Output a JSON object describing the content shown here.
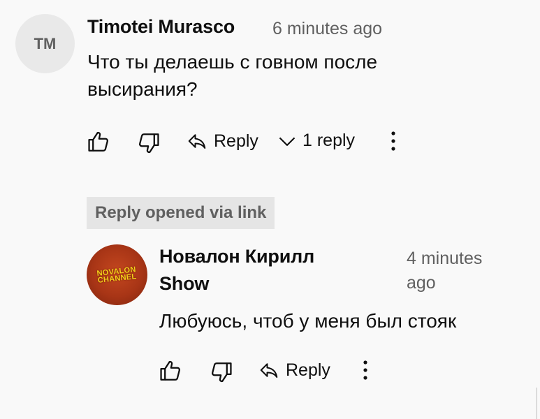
{
  "comment": {
    "avatar_initials": "TM",
    "author": "Timotei Murasco",
    "time": "6 minutes ago",
    "text_line1": "Что ты делаешь с говном после",
    "text_line2": "высирания?",
    "reply_label": "Reply",
    "replies_label": "1 reply"
  },
  "highlight_chip": "Reply opened via link",
  "reply": {
    "author_line1": "Новалон Кирилл",
    "author_line2": "Show",
    "time_line1": "4 minutes",
    "time_line2": "ago",
    "text": "Любуюсь, чтоб у меня был стояк",
    "reply_label": "Reply",
    "avatar_logo_line1": "NOVALON",
    "avatar_logo_line2": "CHANNEL"
  },
  "icons": [
    "like-icon",
    "dislike-icon",
    "reply-icon",
    "chevron-down-icon",
    "more-vert-icon"
  ],
  "colors": {
    "background": "#f9f9f9",
    "secondary_text": "#606060",
    "chip_bg": "#e5e5e5",
    "avatar_logo": "#f4d11a"
  }
}
